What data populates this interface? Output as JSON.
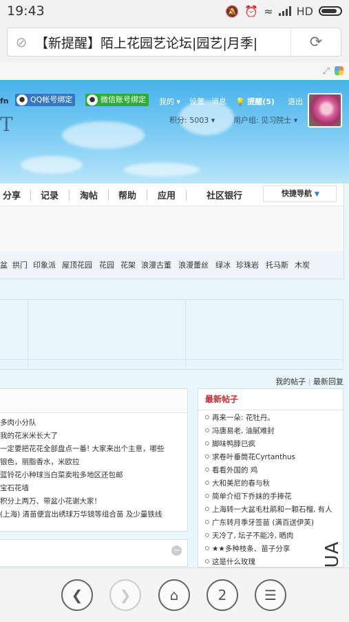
{
  "status": {
    "time": "19:43",
    "network": "HD"
  },
  "browser": {
    "url_text": "【新提醒】陌上花园艺论坛|园艺|月季|",
    "tab_count": "2"
  },
  "header": {
    "fn_text": "fn",
    "qq_bind": "QQ帐号绑定",
    "wechat_bind": "微信账号绑定",
    "my": "我的",
    "settings": "设置",
    "messages": "消息",
    "remind": "提醒(5)",
    "logout": "退出",
    "points": "积分: 5003",
    "usergroup": "用户组: 见习院士",
    "logo_fragment": "T"
  },
  "nav": {
    "items": [
      "分享",
      "记录",
      "淘帖",
      "帮助",
      "应用",
      "社区银行"
    ],
    "quick_nav": "快捷导航"
  },
  "tags": [
    "盆",
    "拱门",
    "印象派",
    "屋顶花园",
    "花园",
    "花架",
    "浪漫古董",
    "浪漫蕾丝",
    "绿冰",
    "珍珠岩",
    "托马斯",
    "木炭"
  ],
  "links": {
    "my_posts": "我的帖子",
    "latest_replies": "最新回复"
  },
  "left_list": [
    "多肉小分队",
    "我的花米米长大了",
    "一定要把花花全部盘点一番! 大家来出个主意，哪些",
    "银色，丽脂香水，米欧拉",
    "蓝铃花小种球当白菜卖啦多地区还包邮",
    "宝石花墙",
    "积分上两万、带盆小花谢大家！",
    "(上海) 清苗便宜出绣球万华镜等组合苗 及少量铁线"
  ],
  "right_panel": {
    "title": "最新帖子",
    "items": [
      "再来一朵: 花牡丹。",
      "冯唐易老, 油腻难封",
      "脚味鸭脖已疯",
      "求卷叶垂筒花Cyrtanthus",
      "看看外国的 鸡",
      "大和美尼的春与秋",
      "简单介绍下乔妹的手捧花",
      "上海转一大盆毛杜鹃和一颗石榴, 有人",
      "广东转月季牙签苗 (满百送伊芙)",
      "天冷了, 坛子不能冷, 晒肉",
      "★★多种枝条、苗子分享",
      "这是什么玫瑰"
    ]
  },
  "watermark": "MSHUA",
  "colors": {
    "accent_red": "#d0262e",
    "qq_blue": "#3478c4",
    "wechat_green": "#2cae36",
    "sky": "#47b2ec"
  }
}
